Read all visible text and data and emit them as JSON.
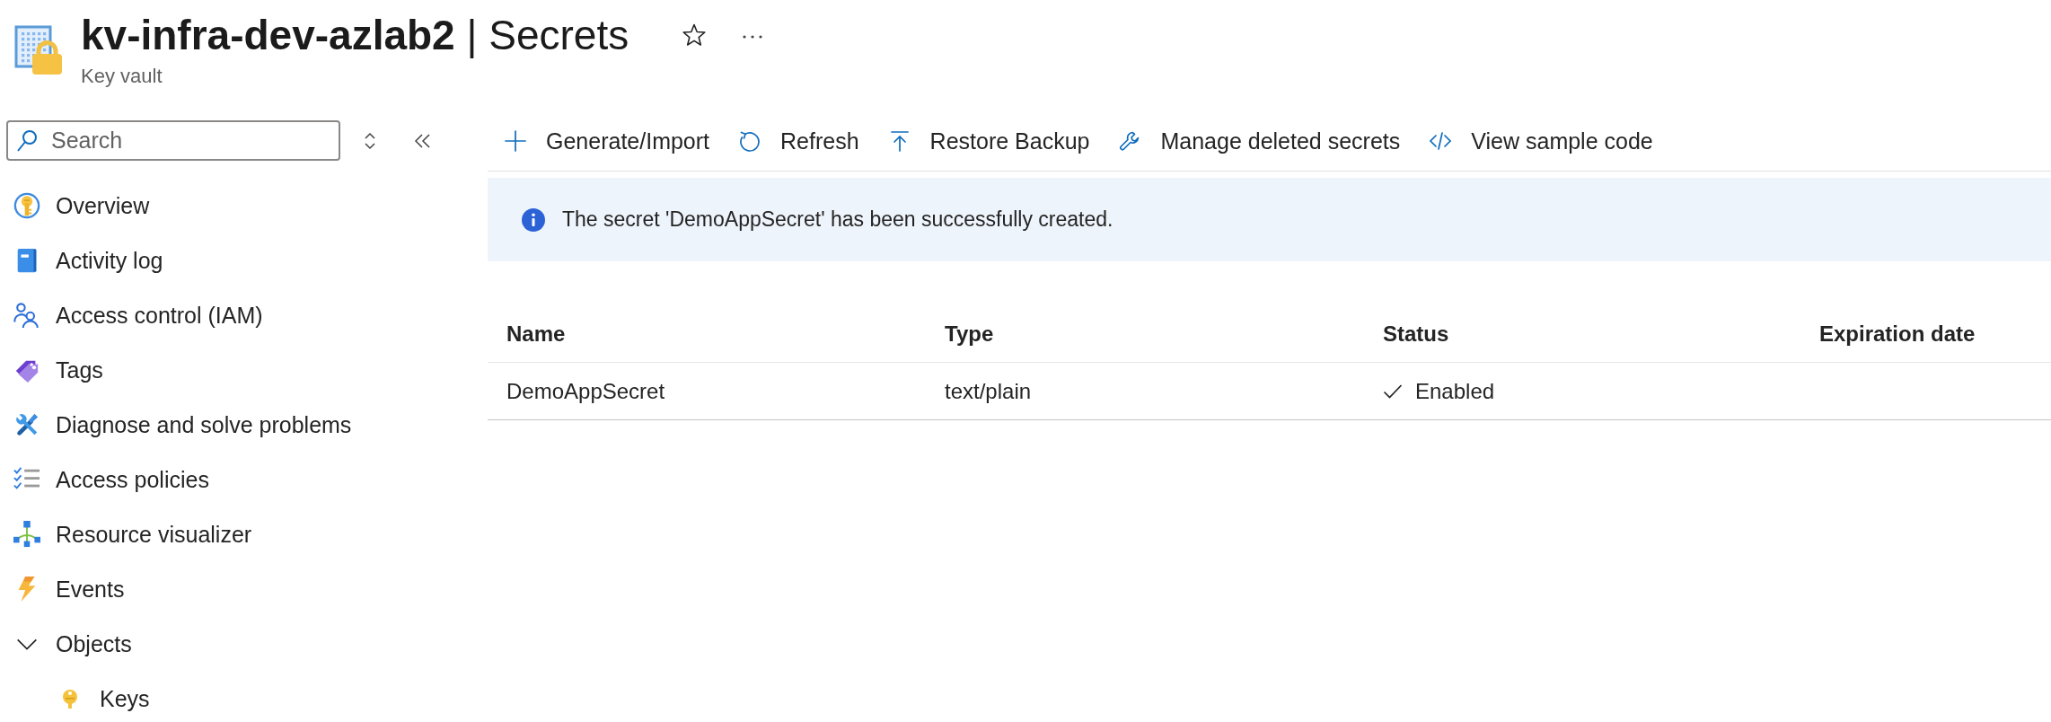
{
  "header": {
    "title": "**kv-infra-dev-azlab2** | Secrets",
    "subtitle": "Key vault"
  },
  "sidebar": {
    "search": {
      "placeholder": "Search"
    },
    "items": [
      {
        "label": "Overview",
        "kind": "link"
      },
      {
        "label": "Activity log",
        "kind": "link"
      },
      {
        "label": "Access control (IAM)",
        "kind": "link"
      },
      {
        "label": "Tags",
        "kind": "link"
      },
      {
        "label": "Diagnose and solve problems",
        "kind": "link"
      },
      {
        "label": "Access policies",
        "kind": "link"
      },
      {
        "label": "Resource visualizer",
        "kind": "link"
      },
      {
        "label": "Events",
        "kind": "link"
      },
      {
        "label": "Objects",
        "kind": "group",
        "expanded": true,
        "children": [
          {
            "label": "Keys",
            "kind": "link"
          }
        ]
      }
    ]
  },
  "toolbar": {
    "buttons": [
      {
        "label": "Generate/Import"
      },
      {
        "label": "Refresh"
      },
      {
        "label": "Restore Backup"
      },
      {
        "label": "Manage deleted secrets"
      },
      {
        "label": "View sample code"
      }
    ]
  },
  "notification": {
    "message": "The secret 'DemoAppSecret' has been successfully created."
  },
  "table": {
    "columns": [
      "Name",
      "Type",
      "Status",
      "Expiration date"
    ],
    "rows": [
      {
        "name": "DemoAppSecret",
        "type": "text/plain",
        "status": {
          "label": "Enabled",
          "enabled": true
        }
      }
    ]
  }
}
